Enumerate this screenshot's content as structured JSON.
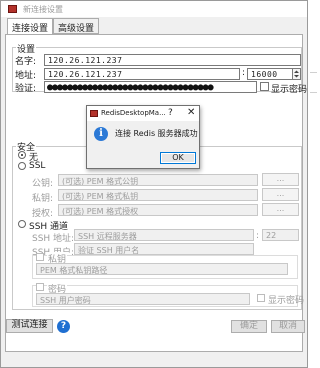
{
  "window": {
    "title": "新连接设置"
  },
  "tabs": [
    {
      "label": "连接设置",
      "active": true
    },
    {
      "label": "高级设置",
      "active": false
    }
  ],
  "main": {
    "legend": "设置",
    "name_label": "名字:",
    "name_value": "120.26.121.237",
    "host_label": "地址:",
    "host_value": "120.26.121.237",
    "port_value": "16000",
    "auth_label": "验证:",
    "auth_dots": "●●●●●●●●●●●●●●●●●●●●●●●●●●●●●●●●●",
    "show_password_label": "显示密码"
  },
  "security": {
    "legend": "安全",
    "none_label": "无",
    "ssl_label": "SSL",
    "public_key_label": "公钥:",
    "public_key_placeholder": "(可选) PEM 格式公钥",
    "private_key_label": "私钥:",
    "private_key_placeholder": "(可选) PEM 格式私钥",
    "authority_label": "授权:",
    "authority_placeholder": "(可选) PEM 格式授权",
    "browse_label": "...",
    "ssh_label": "SSH 通道",
    "ssh_host_label": "SSH 地址:",
    "ssh_host_placeholder": "SSH 远程服务器",
    "ssh_port_value": "22",
    "ssh_user_label": "SSH 用户:",
    "ssh_user_placeholder": "验证 SSH 用户名",
    "private_key_checkbox_label": "私钥",
    "private_key_path_placeholder": "PEM 格式私钥路径",
    "password_checkbox_label": "密码",
    "password_placeholder": "SSH 用户密码",
    "ssh_show_password_label": "显示密码"
  },
  "dialog": {
    "title": "RedisDesktopMa...",
    "help_glyph": "?",
    "close_glyph": "✕",
    "message": "连接 Redis 服务器成功",
    "ok_label": "OK",
    "info_glyph": "i"
  },
  "footer": {
    "test_label": "测试连接",
    "help_glyph": "?",
    "ok_label": "确定",
    "cancel_label": "取消"
  },
  "colors": {
    "accent": "#0078d7",
    "info_icon": "#2b79d6",
    "help_icon": "#1f6fd1",
    "app_icon": "#b3322b"
  }
}
